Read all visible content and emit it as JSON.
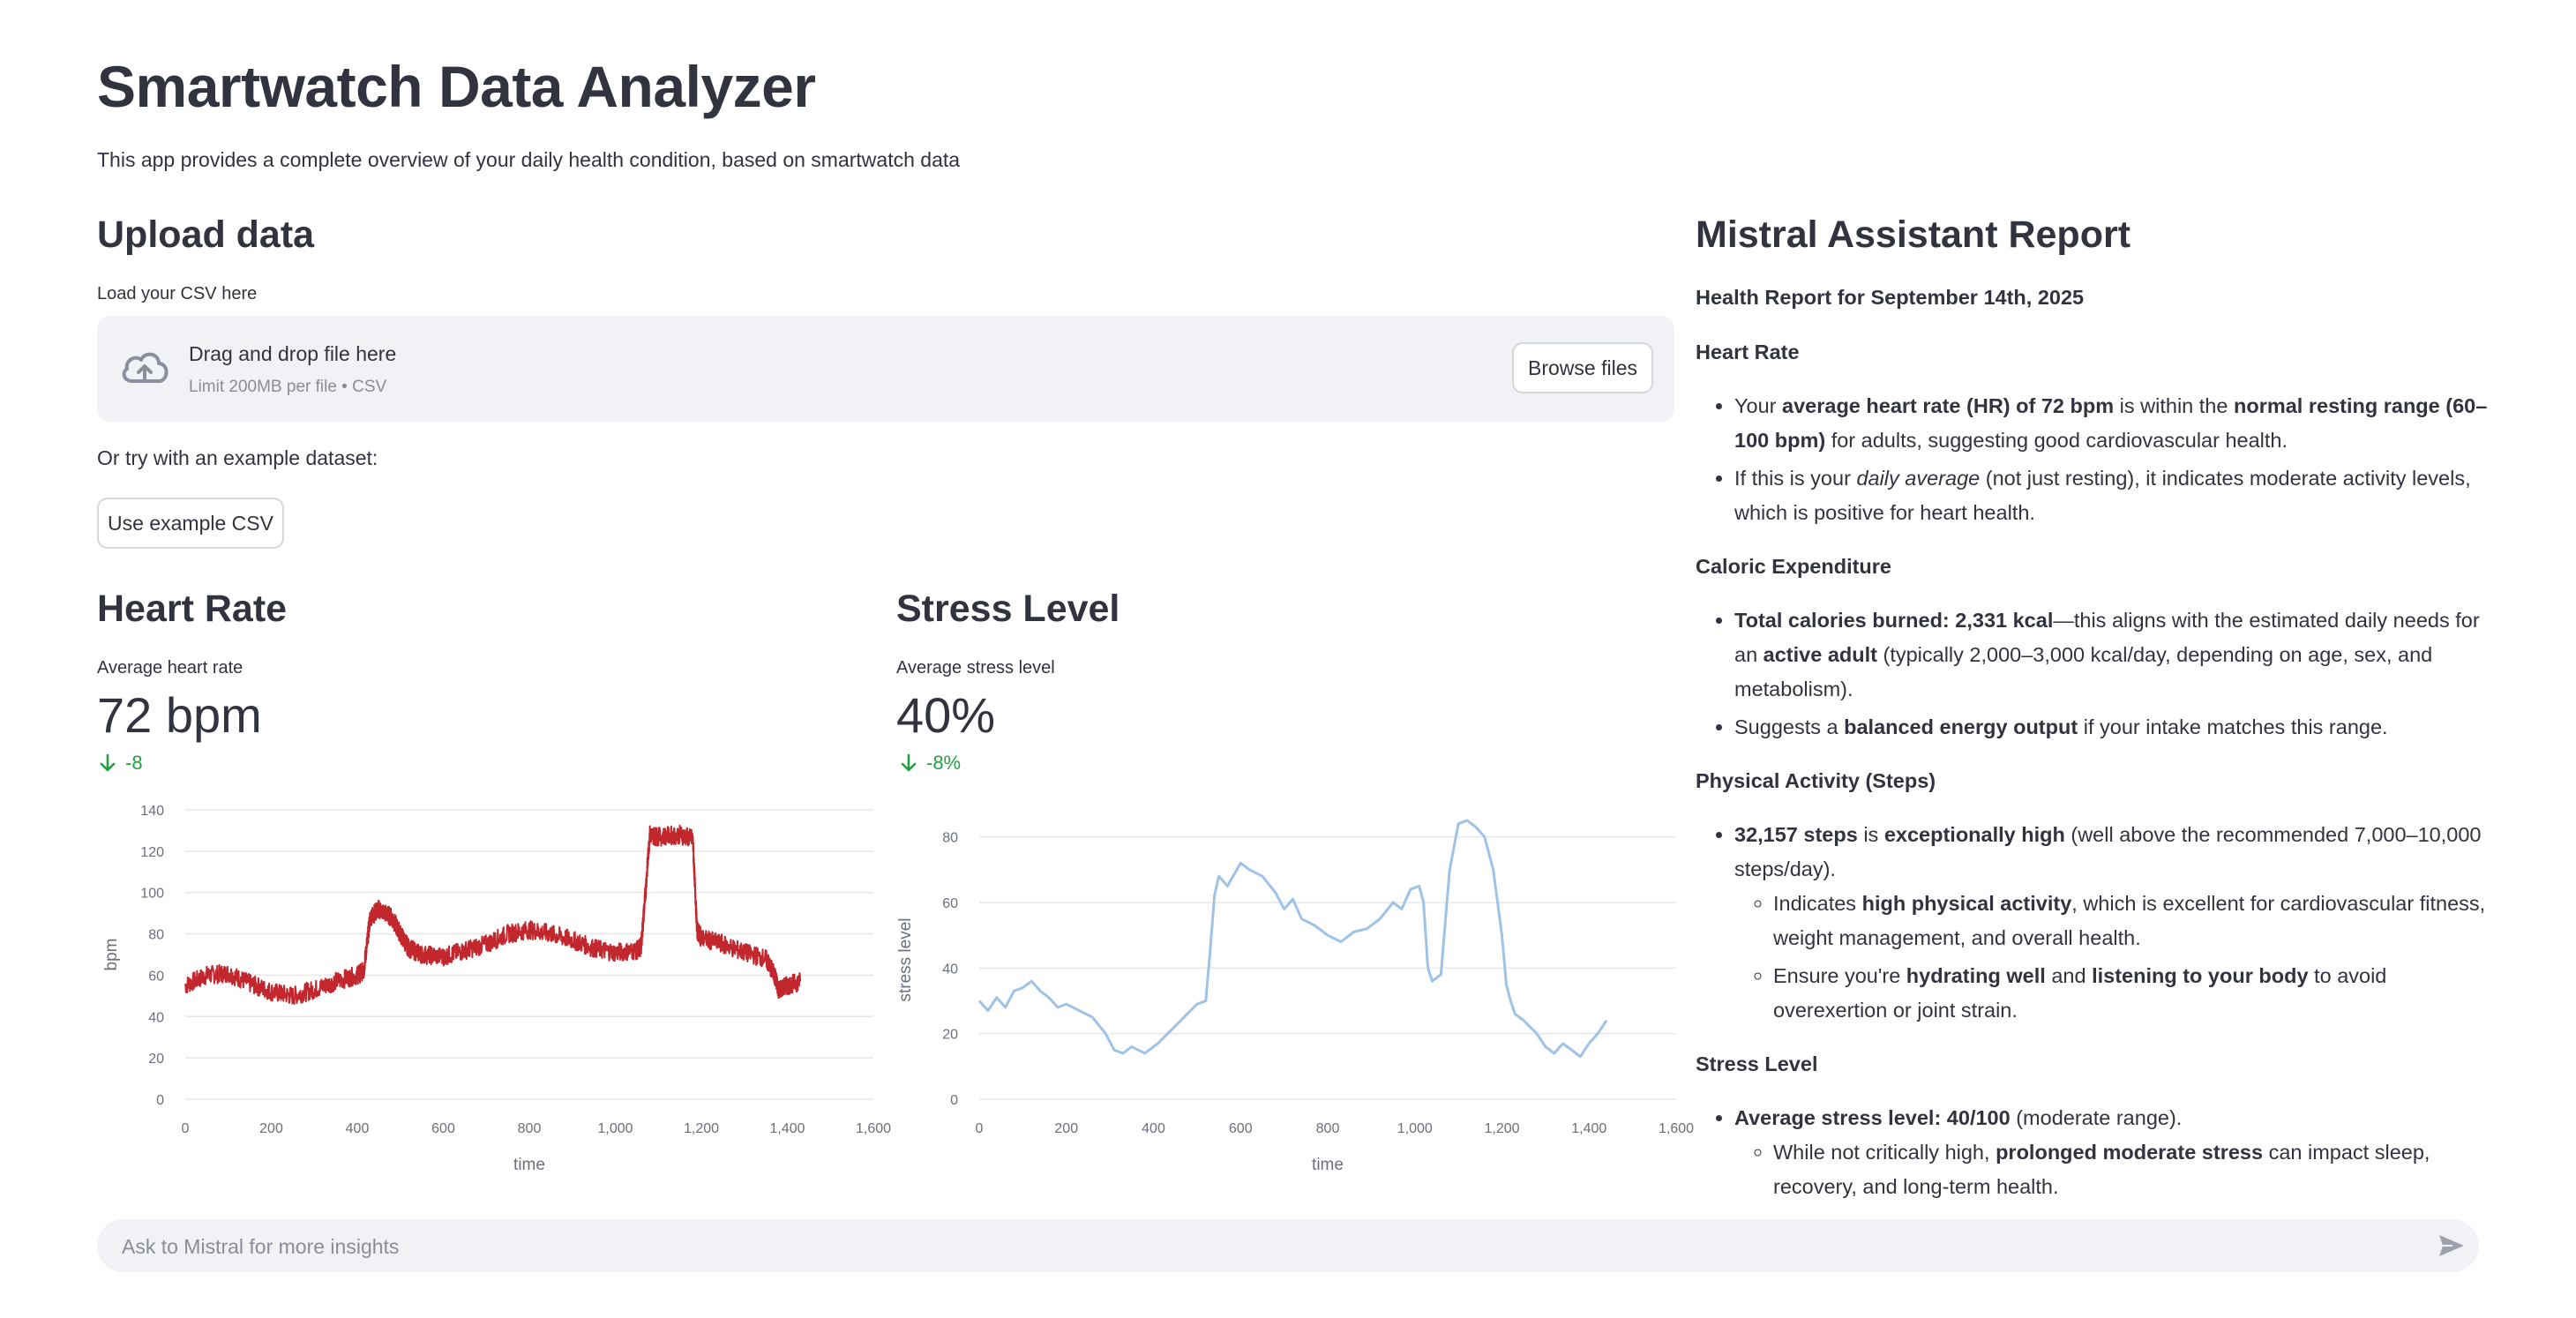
{
  "app": {
    "title": "Smartwatch Data Analyzer",
    "subtitle": "This app provides a complete overview of your daily health condition, based on smartwatch data"
  },
  "upload": {
    "heading": "Upload data",
    "label": "Load your CSV here",
    "drag_text": "Drag and drop file here",
    "limit_text": "Limit 200MB per file • CSV",
    "browse_label": "Browse files",
    "example_prompt": "Or try with an example dataset:",
    "example_button": "Use example CSV",
    "icon": "cloud-upload-icon"
  },
  "heart": {
    "heading": "Heart Rate",
    "metric_label": "Average heart rate",
    "metric_value": "72 bpm",
    "delta": "-8",
    "delta_icon": "arrow-down-icon"
  },
  "stress": {
    "heading": "Stress Level",
    "metric_label": "Average stress level",
    "metric_value": "40%",
    "delta": "-8%",
    "delta_icon": "arrow-down-icon"
  },
  "chart_data": [
    {
      "type": "line",
      "xlabel": "time",
      "ylabel": "bpm",
      "xlim": [
        0,
        1600
      ],
      "ylim": [
        0,
        140
      ],
      "xticks": [
        "0",
        "200",
        "400",
        "600",
        "800",
        "1,000",
        "1,200",
        "1,400",
        "1,600"
      ],
      "yticks": [
        "0",
        "20",
        "40",
        "60",
        "80",
        "100",
        "120",
        "140"
      ],
      "color": "#c1272d",
      "series": [
        {
          "x": [
            0,
            50,
            100,
            150,
            200,
            250,
            300,
            350,
            400,
            415,
            430,
            450,
            480,
            500,
            520,
            550,
            600,
            650,
            700,
            750,
            800,
            850,
            900,
            950,
            1000,
            1050,
            1060,
            1070,
            1080,
            1100,
            1150,
            1180,
            1190,
            1200,
            1250,
            1300,
            1350,
            1370,
            1380,
            1400,
            1430
          ],
          "y": [
            55,
            60,
            61,
            56,
            52,
            50,
            53,
            57,
            60,
            62,
            88,
            92,
            88,
            80,
            73,
            70,
            69,
            72,
            75,
            80,
            82,
            80,
            77,
            73,
            71,
            72,
            74,
            100,
            128,
            127,
            128,
            126,
            82,
            78,
            75,
            71,
            68,
            60,
            53,
            55,
            57
          ]
        }
      ]
    },
    {
      "type": "line",
      "xlabel": "time",
      "ylabel": "stress level",
      "xlim": [
        0,
        1600
      ],
      "ylim": [
        0,
        85
      ],
      "xticks": [
        "0",
        "200",
        "400",
        "600",
        "800",
        "1,000",
        "1,200",
        "1,400",
        "1,600"
      ],
      "yticks": [
        "0",
        "20",
        "40",
        "60",
        "80"
      ],
      "color": "#9ec3e6",
      "series": [
        {
          "x": [
            0,
            20,
            40,
            60,
            80,
            100,
            120,
            140,
            160,
            180,
            200,
            230,
            260,
            290,
            310,
            330,
            350,
            380,
            410,
            440,
            470,
            500,
            520,
            530,
            540,
            550,
            570,
            600,
            620,
            650,
            680,
            700,
            720,
            740,
            770,
            800,
            830,
            860,
            890,
            920,
            950,
            970,
            990,
            1010,
            1020,
            1030,
            1040,
            1060,
            1080,
            1100,
            1120,
            1140,
            1160,
            1180,
            1200,
            1210,
            1220,
            1230,
            1250,
            1280,
            1300,
            1320,
            1340,
            1360,
            1380,
            1400,
            1420,
            1440
          ],
          "y": [
            30,
            27,
            31,
            28,
            33,
            34,
            36,
            33,
            31,
            28,
            29,
            27,
            25,
            20,
            15,
            14,
            16,
            14,
            17,
            21,
            25,
            29,
            30,
            45,
            62,
            68,
            65,
            72,
            70,
            68,
            63,
            58,
            61,
            55,
            53,
            50,
            48,
            51,
            52,
            55,
            60,
            58,
            64,
            65,
            60,
            40,
            36,
            38,
            70,
            84,
            85,
            83,
            80,
            70,
            50,
            35,
            30,
            26,
            24,
            20,
            16,
            14,
            17,
            15,
            13,
            17,
            20,
            24
          ]
        }
      ]
    }
  ],
  "report": {
    "heading": "Mistral Assistant Report",
    "date_line": "Health Report for September 14th, 2025",
    "s1": "Heart Rate",
    "s1_b1": [
      {
        "t": "Your ",
        "b": false
      },
      {
        "t": "average heart rate (HR) of 72 bpm",
        "b": true
      },
      {
        "t": " is within the ",
        "b": false
      },
      {
        "t": "normal resting range (60–100 bpm)",
        "b": true
      },
      {
        "t": " for adults, suggesting good cardiovascular health.",
        "b": false
      }
    ],
    "s1_b2": [
      {
        "t": "If this is your ",
        "b": false
      },
      {
        "t": "daily average",
        "i": true
      },
      {
        "t": " (not just resting), it indicates moderate activity levels, which is positive for heart health.",
        "b": false
      }
    ],
    "s2": "Caloric Expenditure",
    "s2_b1": [
      {
        "t": "Total calories burned: 2,331 kcal",
        "b": true
      },
      {
        "t": "—this aligns with the estimated daily needs for an ",
        "b": false
      },
      {
        "t": "active adult",
        "b": true
      },
      {
        "t": " (typically 2,000–3,000 kcal/day, depending on age, sex, and metabolism).",
        "b": false
      }
    ],
    "s2_b2": [
      {
        "t": "Suggests a ",
        "b": false
      },
      {
        "t": "balanced energy output",
        "b": true
      },
      {
        "t": " if your intake matches this range.",
        "b": false
      }
    ],
    "s3": "Physical Activity (Steps)",
    "s3_b1": [
      {
        "t": "32,157 steps",
        "b": true
      },
      {
        "t": " is ",
        "b": false
      },
      {
        "t": "exceptionally high",
        "b": true
      },
      {
        "t": " (well above the recommended 7,000–10,000 steps/day).",
        "b": false
      }
    ],
    "s3_sb1": [
      {
        "t": "Indicates ",
        "b": false
      },
      {
        "t": "high physical activity",
        "b": true
      },
      {
        "t": ", which is excellent for cardiovascular fitness, weight management, and overall health.",
        "b": false
      }
    ],
    "s3_sb2": [
      {
        "t": "Ensure you're ",
        "b": false
      },
      {
        "t": "hydrating well",
        "b": true
      },
      {
        "t": " and ",
        "b": false
      },
      {
        "t": "listening to your body",
        "b": true
      },
      {
        "t": " to avoid overexertion or joint strain.",
        "b": false
      }
    ],
    "s4": "Stress Level",
    "s4_b1": [
      {
        "t": "Average stress level: 40/100",
        "b": true
      },
      {
        "t": " (moderate range).",
        "b": false
      }
    ],
    "s4_sb1": [
      {
        "t": "While not critically high, ",
        "b": false
      },
      {
        "t": "prolonged moderate stress",
        "b": true
      },
      {
        "t": " can impact sleep, recovery, and long-term health.",
        "b": false
      }
    ]
  },
  "chat": {
    "placeholder": "Ask to Mistral for more insights",
    "send_icon": "send-icon"
  }
}
